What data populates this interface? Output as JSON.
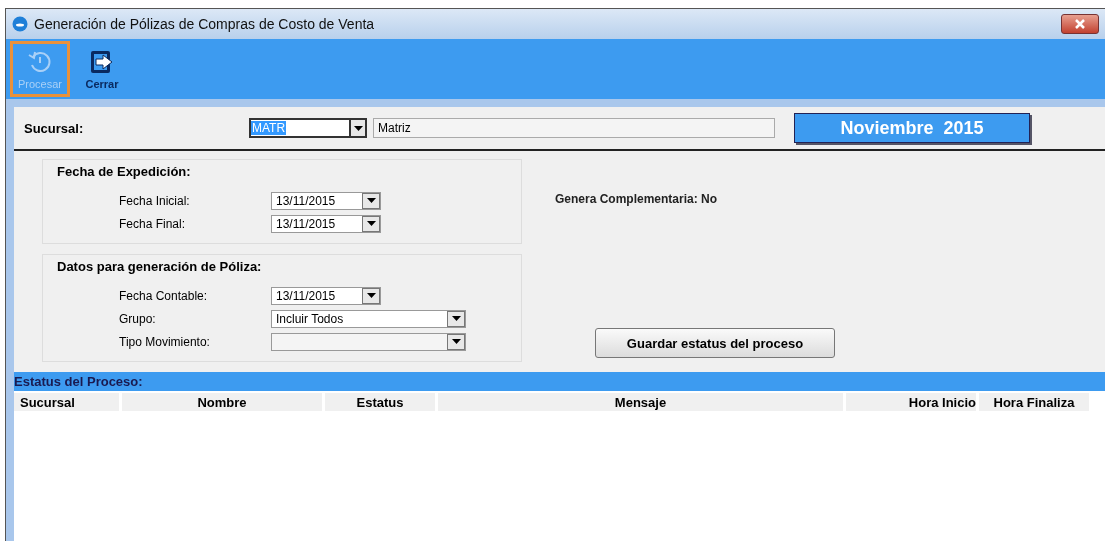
{
  "window": {
    "title": "Generación de Pólizas de Compras de Costo de Venta"
  },
  "toolbar": [
    {
      "kind": "process",
      "label": "Procesar",
      "disabled": true,
      "focused": true
    },
    {
      "kind": "exit",
      "label": "Cerrar",
      "disabled": false,
      "focused": false
    }
  ],
  "sucursal": {
    "label": "Sucursal:",
    "code": "MATR",
    "name": "Matriz"
  },
  "period": "Noviembre  2015",
  "fecha_expedicion": {
    "title": "Fecha de Expedición:",
    "fields": [
      {
        "label": "Fecha Inicial:",
        "value": "13/11/2015"
      },
      {
        "label": "Fecha Final:",
        "value": "13/11/2015"
      }
    ]
  },
  "datos_poliza": {
    "title": "Datos para generación de Póliza:",
    "fields": [
      {
        "kind": "date",
        "label": "Fecha Contable:",
        "value": "13/11/2015"
      },
      {
        "kind": "combo",
        "label": "Grupo:",
        "value": "Incluir Todos"
      },
      {
        "kind": "combo",
        "label": "Tipo Movimiento:"
      }
    ]
  },
  "complementaria": {
    "label": "Genera Complementaria:",
    "value": "No"
  },
  "save_button": "Guardar estatus del proceso",
  "status": {
    "title": "Estatus del Proceso:",
    "columns": [
      "Sucursal",
      "Nombre",
      "Estatus",
      "Mensaje",
      "Hora Inicio",
      "Hora Finaliza"
    ]
  }
}
